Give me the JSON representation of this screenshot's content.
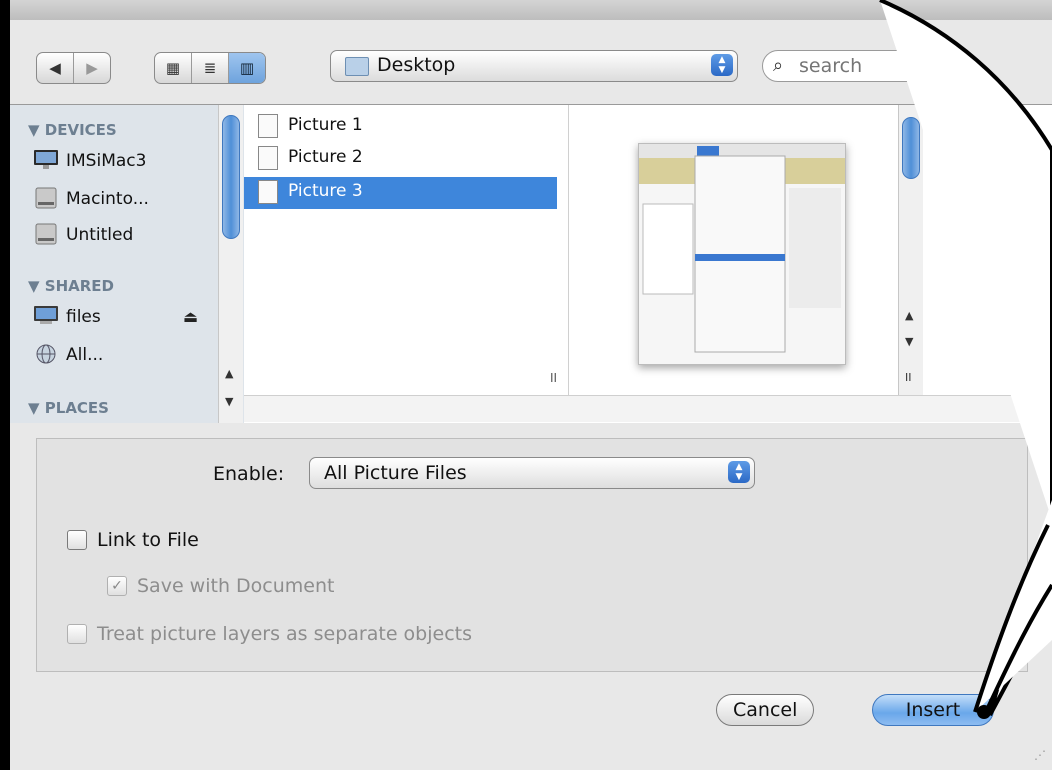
{
  "toolbar": {
    "back_icon": "back-arrow-icon",
    "forward_icon": "forward-arrow-icon",
    "view_icons": [
      "icon-view-icon",
      "list-view-icon",
      "column-view-icon"
    ],
    "location": "Desktop",
    "search_placeholder": "search"
  },
  "sidebar": {
    "sections": [
      {
        "title": "DEVICES",
        "items": [
          "IMSiMac3",
          "Macinto...",
          "Untitled"
        ]
      },
      {
        "title": "SHARED",
        "items": [
          "files",
          "All..."
        ]
      },
      {
        "title": "PLACES",
        "items": []
      }
    ]
  },
  "files": [
    {
      "name": "Picture 1",
      "selected": false
    },
    {
      "name": "Picture 2",
      "selected": false
    },
    {
      "name": "Picture 3",
      "selected": true
    }
  ],
  "options": {
    "enable_label": "Enable:",
    "enable_value": "All Picture Files",
    "link_to_file": "Link to File",
    "save_with_document": "Save with Document",
    "treat_layers": "Treat picture layers as separate objects",
    "link_checked": false,
    "save_checked": true,
    "treat_checked": false
  },
  "buttons": {
    "cancel": "Cancel",
    "insert": "Insert"
  },
  "colors": {
    "selection": "#3e86db",
    "primary_button": "#6aa7ea"
  }
}
